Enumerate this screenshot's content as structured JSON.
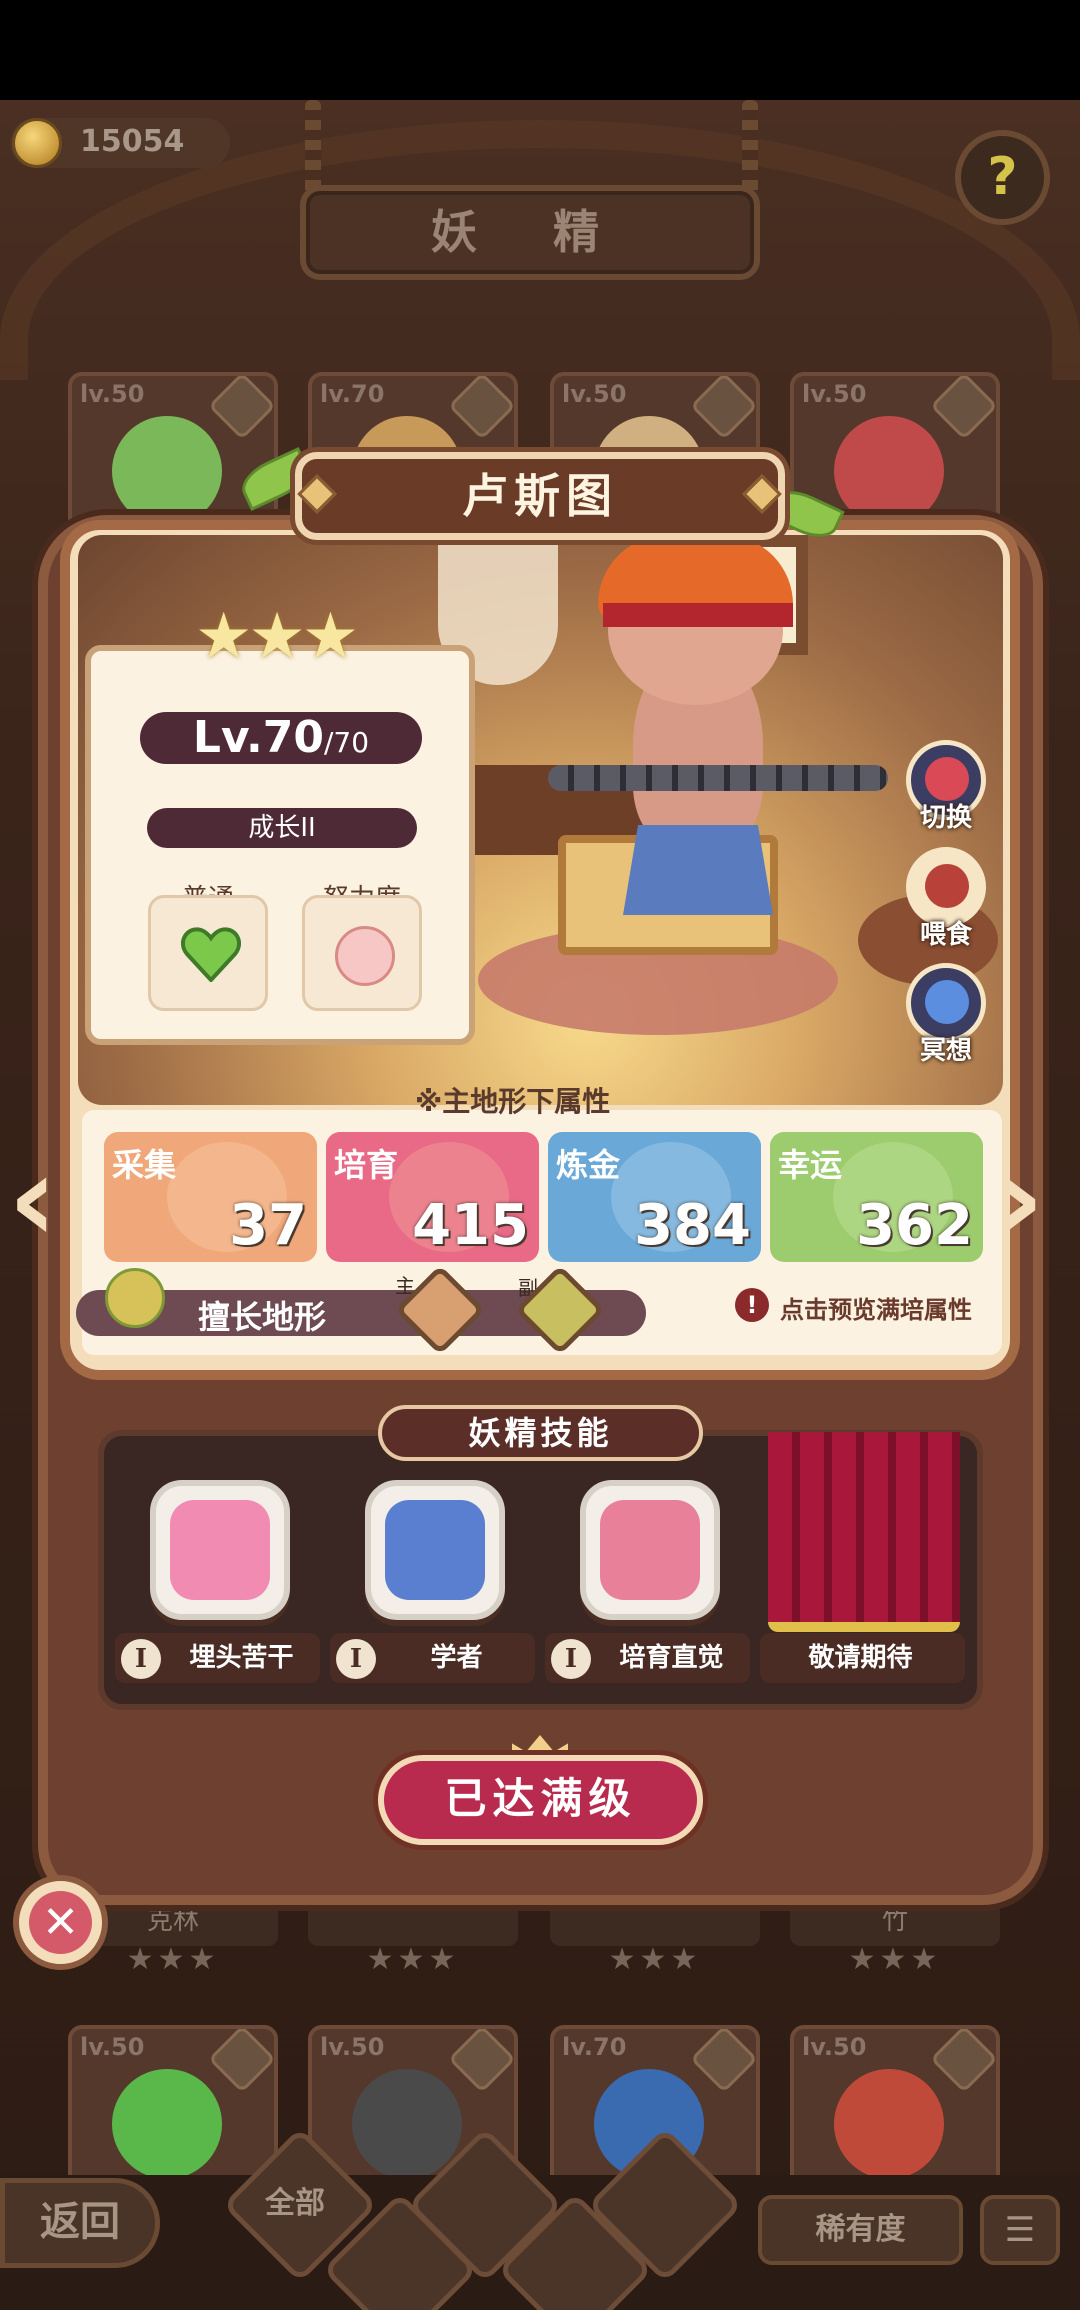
{
  "currency": {
    "icon": "crown-coin-icon",
    "amount": "15054"
  },
  "screen_title": "妖 精",
  "help_icon": "sprout-question-icon",
  "background_cards_top": [
    {
      "level": "lv.50"
    },
    {
      "level": "lv.70"
    },
    {
      "level": "lv.50"
    },
    {
      "level": "lv.50"
    }
  ],
  "background_cards_mid": [
    {
      "name": "克林",
      "stars": "★★★"
    },
    {
      "name": "",
      "stars": "★★★"
    },
    {
      "name": "",
      "stars": "★★★"
    },
    {
      "name": "竹",
      "stars": "★★★"
    }
  ],
  "background_cards_bottom": [
    {
      "level": "lv.50"
    },
    {
      "level": "lv.50"
    },
    {
      "level": "lv.70"
    },
    {
      "level": "lv.50"
    }
  ],
  "fairy": {
    "name": "卢斯图",
    "stars": "★★★",
    "level": "Lv.70",
    "level_max": "/70",
    "growth": "成长II",
    "type_label": "普通",
    "effort_label": "努力度"
  },
  "actions": [
    {
      "label": "切换",
      "icon": "switch-icon"
    },
    {
      "label": "喂食",
      "icon": "meat-icon"
    },
    {
      "label": "冥想",
      "icon": "meditate-icon"
    }
  ],
  "attributes": {
    "note": "※主地形下属性",
    "items": [
      {
        "label": "采集",
        "value": "37",
        "color": "#f0a77a"
      },
      {
        "label": "培育",
        "value": "415",
        "color": "#e86a86"
      },
      {
        "label": "炼金",
        "value": "384",
        "color": "#6aa8d8"
      },
      {
        "label": "幸运",
        "value": "362",
        "color": "#9ccc6e"
      }
    ],
    "terrain_label": "擅长地形",
    "main_tag": "主",
    "sub_tag": "副",
    "preview_text": "点击预览满培属性"
  },
  "skills": {
    "title": "妖精技能",
    "items": [
      {
        "name": "埋头苦干",
        "rank": "I",
        "icon": "angry-face-icon"
      },
      {
        "name": "学者",
        "rank": "I",
        "icon": "shell-icon"
      },
      {
        "name": "培育直觉",
        "rank": "I",
        "icon": "watering-can-icon"
      },
      {
        "name": "敬请期待",
        "icon": "curtain-icon"
      }
    ]
  },
  "max_level_button": "已达满级",
  "close_icon": "close-icon",
  "bottom_bar": {
    "back_label": "返回",
    "filter_all": "全部",
    "rarity_label": "稀有度",
    "sort_icon": "sort-list-icon"
  }
}
